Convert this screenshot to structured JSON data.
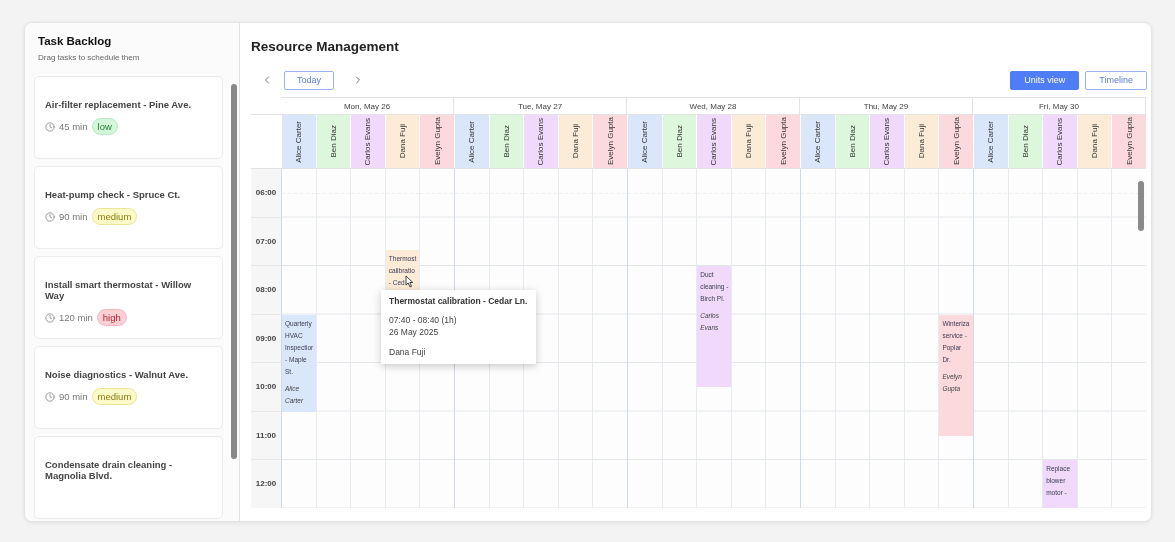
{
  "sidebar": {
    "title": "Task Backlog",
    "subtitle": "Drag tasks to schedule them",
    "tasks": [
      {
        "title": "Air-filter replacement - Pine Ave.",
        "duration": "45 min",
        "priority": {
          "label": "low",
          "kind": "low"
        }
      },
      {
        "title": "Heat-pump check - Spruce Ct.",
        "duration": "90 min",
        "priority": {
          "label": "medium",
          "kind": "medium"
        }
      },
      {
        "title": "Install smart thermostat - Willow Way",
        "duration": "120 min",
        "priority": {
          "label": "high",
          "kind": "high"
        }
      },
      {
        "title": "Noise diagnostics - Walnut Ave.",
        "duration": "90 min",
        "priority": {
          "label": "medium",
          "kind": "medium"
        }
      },
      {
        "title": "Condensate drain cleaning - Magnolia Blvd."
      }
    ]
  },
  "main": {
    "title": "Resource Management",
    "today": "Today",
    "views": [
      {
        "label": "Units view",
        "selected": true
      },
      {
        "label": "Timeline",
        "selected": false
      }
    ]
  },
  "calendar": {
    "hours": [
      "06:00",
      "07:00",
      "08:00",
      "09:00",
      "10:00",
      "11:00",
      "12:00"
    ],
    "days": [
      {
        "label": "Mon, May 26",
        "columns": [
          {
            "name": "Alice Carter",
            "color": "#dae7fb",
            "events": [
              {
                "title": "Quarterly HVAC Inspectior - Maple St.",
                "person": "Alice Carter"
              }
            ]
          },
          {
            "name": "Ben Diaz",
            "color": "#dcf7dc"
          },
          {
            "name": "Carlos Evans",
            "color": "#f0d9fa"
          },
          {
            "name": "Dana Fuji",
            "color": "#fbebd7",
            "events": [
              {
                "title": "Thermost calibratio - Ced"
              }
            ]
          },
          {
            "name": "Evelyn Gupta",
            "color": "#fbd9dc"
          }
        ]
      },
      {
        "label": "Tue, May 27",
        "columns": [
          {
            "name": "Alice Carter",
            "color": "#dae7fb"
          },
          {
            "name": "Ben Diaz",
            "color": "#dcf7dc"
          },
          {
            "name": "Carlos Evans",
            "color": "#f0d9fa"
          },
          {
            "name": "Dana Fuji",
            "color": "#fbebd7"
          },
          {
            "name": "Evelyn Gupta",
            "color": "#fbd9dc"
          }
        ]
      },
      {
        "label": "Wed, May 28",
        "columns": [
          {
            "name": "Alice Carter",
            "color": "#dae7fb"
          },
          {
            "name": "Ben Diaz",
            "color": "#dcf7dc"
          },
          {
            "name": "Carlos Evans",
            "color": "#f0d9fa",
            "events": [
              {
                "title": "Duct cleaning - Birch Pl.",
                "person": "Carlos Evans"
              }
            ]
          },
          {
            "name": "Dana Fuji",
            "color": "#fbebd7"
          },
          {
            "name": "Evelyn Gupta",
            "color": "#fbd9dc"
          }
        ]
      },
      {
        "label": "Thu, May 29",
        "columns": [
          {
            "name": "Alice Carter",
            "color": "#dae7fb"
          },
          {
            "name": "Ben Diaz",
            "color": "#dcf7dc"
          },
          {
            "name": "Carlos Evans",
            "color": "#f0d9fa"
          },
          {
            "name": "Dana Fuji",
            "color": "#fbebd7"
          },
          {
            "name": "Evelyn Gupta",
            "color": "#fbd9dc",
            "events": [
              {
                "title": "Winteriza service - Poplar Dr.",
                "person": "Evelyn Gupta"
              }
            ]
          }
        ]
      },
      {
        "label": "Fri, May 30",
        "columns": [
          {
            "name": "Alice Carter",
            "color": "#dae7fb"
          },
          {
            "name": "Ben Diaz",
            "color": "#dcf7dc"
          },
          {
            "name": "Carlos Evans",
            "color": "#f0d9fa",
            "events": [
              {
                "title": "Replace blower motor -"
              }
            ]
          },
          {
            "name": "Dana Fuji",
            "color": "#fbebd7"
          },
          {
            "name": "Evelyn Gupta",
            "color": "#fbd9dc"
          }
        ]
      }
    ]
  },
  "tooltip": {
    "title": "Thermostat calibration - Cedar Ln.",
    "time": "07:40 - 08:40 (1h)",
    "date": "26 May 2025",
    "person": "Dana Fuji"
  }
}
